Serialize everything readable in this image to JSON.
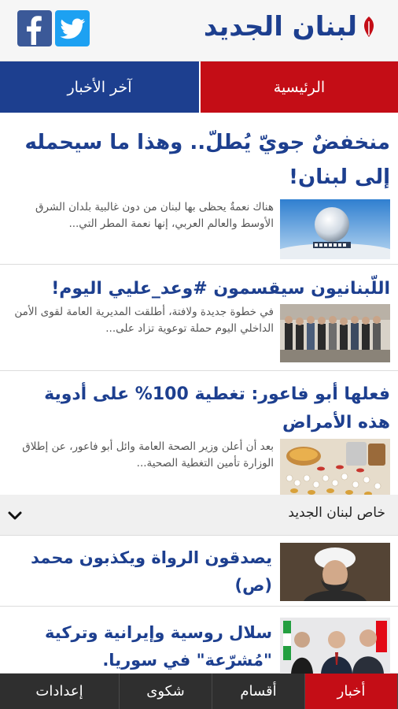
{
  "header": {
    "logo_text": "لبنان الجديد",
    "social": {
      "facebook_icon": "facebook-icon",
      "twitter_icon": "twitter-icon"
    }
  },
  "tabs": {
    "home": "الرئيسية",
    "latest": "آخر الأخبار"
  },
  "articles": [
    {
      "title": "منخفضٌ جويّ يُطلّ.. وهذا ما سيحمله إلى لبنان!",
      "excerpt": "هناك نعمةٌ يحظى بها لبنان من دون غالبية بلدان الشرق الأوسط والعالم العربي، إنها نعمة المطر التي..."
    },
    {
      "title": "اللّبنانيون سيقسمون #وعد_عليي اليوم!",
      "excerpt": "في خطوة جديدة ولافتة، أطلقت المديرية العامة لقوى الأمن الداخلي اليوم حملة توعوية تزاد على..."
    },
    {
      "title": "فعلها أبو فاعور: تغطية 100% على أدوية هذه الأمراض",
      "excerpt": "بعد أن أعلن وزير الصحة العامة وائل أبو فاعور، عن إطلاق الوزارة تأمين التغطية الصحية..."
    }
  ],
  "section": {
    "title": "خاص لبنان الجديد",
    "chevron_icon": "chevron-down-icon"
  },
  "special": [
    {
      "title": "يصدقون الرواة ويكذبون محمد (ص)"
    },
    {
      "title": "سلال روسية وإيرانية وتركية \"مُشرّعة\" في سوريا."
    }
  ],
  "bottom_nav": {
    "news": "أخبار",
    "sections": "أقسام",
    "complaint": "شكوى",
    "settings": "إعدادات"
  },
  "colors": {
    "brand_blue": "#1d3f8f",
    "brand_red": "#c40d16",
    "nav_dark": "#2f2f2f"
  }
}
